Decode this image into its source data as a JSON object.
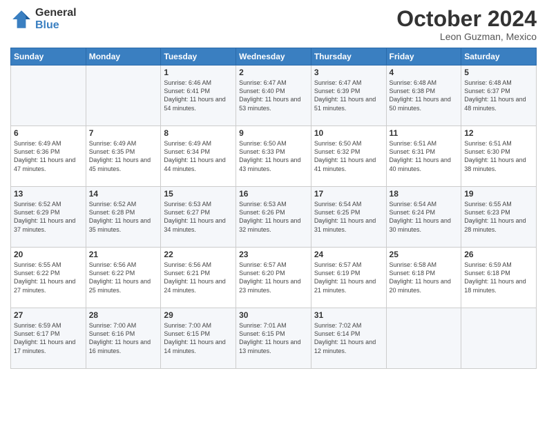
{
  "logo": {
    "general": "General",
    "blue": "Blue"
  },
  "header": {
    "month": "October 2024",
    "location": "Leon Guzman, Mexico"
  },
  "weekdays": [
    "Sunday",
    "Monday",
    "Tuesday",
    "Wednesday",
    "Thursday",
    "Friday",
    "Saturday"
  ],
  "weeks": [
    [
      {
        "day": "",
        "info": ""
      },
      {
        "day": "",
        "info": ""
      },
      {
        "day": "1",
        "info": "Sunrise: 6:46 AM\nSunset: 6:41 PM\nDaylight: 11 hours and 54 minutes."
      },
      {
        "day": "2",
        "info": "Sunrise: 6:47 AM\nSunset: 6:40 PM\nDaylight: 11 hours and 53 minutes."
      },
      {
        "day": "3",
        "info": "Sunrise: 6:47 AM\nSunset: 6:39 PM\nDaylight: 11 hours and 51 minutes."
      },
      {
        "day": "4",
        "info": "Sunrise: 6:48 AM\nSunset: 6:38 PM\nDaylight: 11 hours and 50 minutes."
      },
      {
        "day": "5",
        "info": "Sunrise: 6:48 AM\nSunset: 6:37 PM\nDaylight: 11 hours and 48 minutes."
      }
    ],
    [
      {
        "day": "6",
        "info": "Sunrise: 6:49 AM\nSunset: 6:36 PM\nDaylight: 11 hours and 47 minutes."
      },
      {
        "day": "7",
        "info": "Sunrise: 6:49 AM\nSunset: 6:35 PM\nDaylight: 11 hours and 45 minutes."
      },
      {
        "day": "8",
        "info": "Sunrise: 6:49 AM\nSunset: 6:34 PM\nDaylight: 11 hours and 44 minutes."
      },
      {
        "day": "9",
        "info": "Sunrise: 6:50 AM\nSunset: 6:33 PM\nDaylight: 11 hours and 43 minutes."
      },
      {
        "day": "10",
        "info": "Sunrise: 6:50 AM\nSunset: 6:32 PM\nDaylight: 11 hours and 41 minutes."
      },
      {
        "day": "11",
        "info": "Sunrise: 6:51 AM\nSunset: 6:31 PM\nDaylight: 11 hours and 40 minutes."
      },
      {
        "day": "12",
        "info": "Sunrise: 6:51 AM\nSunset: 6:30 PM\nDaylight: 11 hours and 38 minutes."
      }
    ],
    [
      {
        "day": "13",
        "info": "Sunrise: 6:52 AM\nSunset: 6:29 PM\nDaylight: 11 hours and 37 minutes."
      },
      {
        "day": "14",
        "info": "Sunrise: 6:52 AM\nSunset: 6:28 PM\nDaylight: 11 hours and 35 minutes."
      },
      {
        "day": "15",
        "info": "Sunrise: 6:53 AM\nSunset: 6:27 PM\nDaylight: 11 hours and 34 minutes."
      },
      {
        "day": "16",
        "info": "Sunrise: 6:53 AM\nSunset: 6:26 PM\nDaylight: 11 hours and 32 minutes."
      },
      {
        "day": "17",
        "info": "Sunrise: 6:54 AM\nSunset: 6:25 PM\nDaylight: 11 hours and 31 minutes."
      },
      {
        "day": "18",
        "info": "Sunrise: 6:54 AM\nSunset: 6:24 PM\nDaylight: 11 hours and 30 minutes."
      },
      {
        "day": "19",
        "info": "Sunrise: 6:55 AM\nSunset: 6:23 PM\nDaylight: 11 hours and 28 minutes."
      }
    ],
    [
      {
        "day": "20",
        "info": "Sunrise: 6:55 AM\nSunset: 6:22 PM\nDaylight: 11 hours and 27 minutes."
      },
      {
        "day": "21",
        "info": "Sunrise: 6:56 AM\nSunset: 6:22 PM\nDaylight: 11 hours and 25 minutes."
      },
      {
        "day": "22",
        "info": "Sunrise: 6:56 AM\nSunset: 6:21 PM\nDaylight: 11 hours and 24 minutes."
      },
      {
        "day": "23",
        "info": "Sunrise: 6:57 AM\nSunset: 6:20 PM\nDaylight: 11 hours and 23 minutes."
      },
      {
        "day": "24",
        "info": "Sunrise: 6:57 AM\nSunset: 6:19 PM\nDaylight: 11 hours and 21 minutes."
      },
      {
        "day": "25",
        "info": "Sunrise: 6:58 AM\nSunset: 6:18 PM\nDaylight: 11 hours and 20 minutes."
      },
      {
        "day": "26",
        "info": "Sunrise: 6:59 AM\nSunset: 6:18 PM\nDaylight: 11 hours and 18 minutes."
      }
    ],
    [
      {
        "day": "27",
        "info": "Sunrise: 6:59 AM\nSunset: 6:17 PM\nDaylight: 11 hours and 17 minutes."
      },
      {
        "day": "28",
        "info": "Sunrise: 7:00 AM\nSunset: 6:16 PM\nDaylight: 11 hours and 16 minutes."
      },
      {
        "day": "29",
        "info": "Sunrise: 7:00 AM\nSunset: 6:15 PM\nDaylight: 11 hours and 14 minutes."
      },
      {
        "day": "30",
        "info": "Sunrise: 7:01 AM\nSunset: 6:15 PM\nDaylight: 11 hours and 13 minutes."
      },
      {
        "day": "31",
        "info": "Sunrise: 7:02 AM\nSunset: 6:14 PM\nDaylight: 11 hours and 12 minutes."
      },
      {
        "day": "",
        "info": ""
      },
      {
        "day": "",
        "info": ""
      }
    ]
  ]
}
